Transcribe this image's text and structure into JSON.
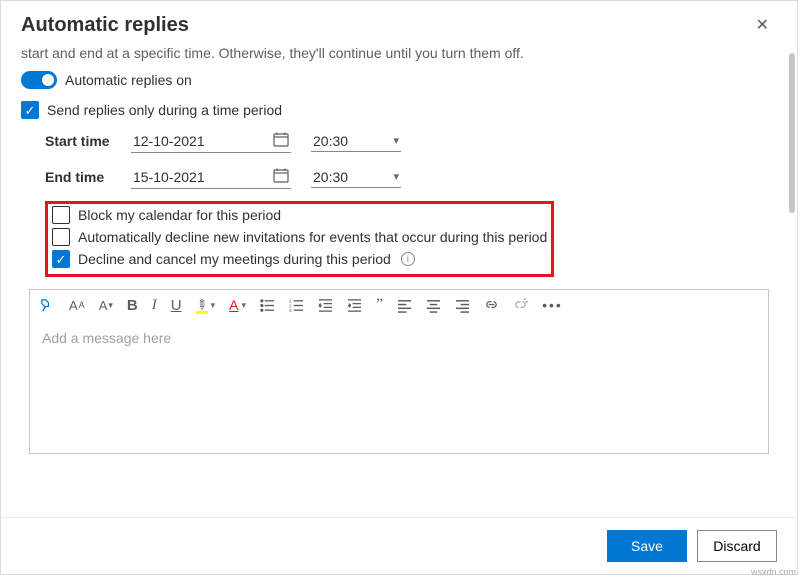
{
  "header": {
    "title": "Automatic replies"
  },
  "intro": "start and end at a specific time. Otherwise, they'll continue until you turn them off.",
  "toggle": {
    "label": "Automatic replies on",
    "on": true
  },
  "period": {
    "label": "Send replies only during a time period",
    "checked": true,
    "start": {
      "label": "Start time",
      "date": "12-10-2021",
      "time": "20:30"
    },
    "end": {
      "label": "End time",
      "date": "15-10-2021",
      "time": "20:30"
    }
  },
  "options": {
    "block": {
      "label": "Block my calendar for this period",
      "checked": false
    },
    "decline": {
      "label": "Automatically decline new invitations for events that occur during this period",
      "checked": false
    },
    "cancel": {
      "label": "Decline and cancel my meetings during this period",
      "checked": true
    }
  },
  "editor": {
    "placeholder": "Add a message here"
  },
  "footer": {
    "save": "Save",
    "discard": "Discard"
  },
  "watermark": "wsxdn.com"
}
